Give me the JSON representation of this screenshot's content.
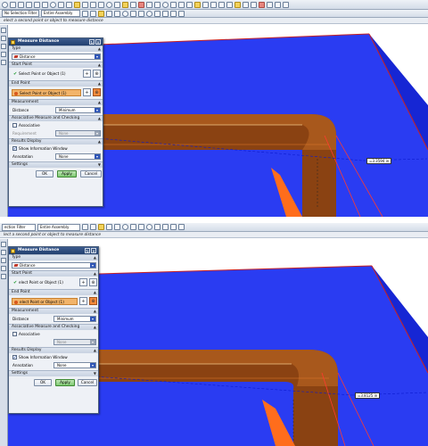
{
  "colors": {
    "accent": "#2244ff",
    "part": "#8a4212",
    "part_light": "#d8691e",
    "highlight": "#f2b46a"
  },
  "top": {
    "toolbar": {
      "selection_filter": "No Selection Filter",
      "assembly_scope": "Entire Assembly"
    },
    "cue": "elect a second point or object to measure distance",
    "dialog": {
      "title": "Measure Distance",
      "type_section": "Type",
      "type_value": "Distance",
      "start_section": "Start Point",
      "start_value": "Select Point or Object (1)",
      "end_section": "End Point",
      "end_value": "Select Point or Object (1)",
      "measurement_section": "Measurement",
      "distance_label": "Distance",
      "distance_value": "Minimum",
      "assoc_section": "Associative Measure and Checking",
      "associative_label": "Associative",
      "requirement_label": "Requirement",
      "requirement_value": "None",
      "results_section": "Results Display",
      "show_info_label": "Show Information Window",
      "annotation_label": "Annotation",
      "annotation_value": "None",
      "settings_section": "Settings",
      "ok": "OK",
      "apply": "Apply",
      "cancel": "Cancel"
    },
    "measure_label": "=3.3594 in"
  },
  "bottom": {
    "toolbar": {
      "selection_filter": "ection Filter",
      "assembly_scope": "Entire Assembly"
    },
    "cue": "lect a second point or object to measure distance",
    "dialog": {
      "title": "Measure Distance",
      "type_section": "Type",
      "type_value": "Distance",
      "start_section": "Start Point",
      "start_value": "elect Point or Object (1)",
      "end_section": "End Point",
      "end_value": "elect Point or Object (1)",
      "measurement_section": "Measurement",
      "distance_label": "Distance",
      "distance_value": "Minimum",
      "assoc_section": "Associative Measure and Checking",
      "associative_label": "Associative",
      "requirement_value": "None",
      "results_section": "Results Display",
      "show_info_label": "Show Information Window",
      "annotation_label": "Annotation",
      "annotation_value": "None",
      "settings_section": "Settings",
      "ok": "OK",
      "apply": "Apply",
      "cancel": "Cancel"
    },
    "measure_label": "=3.8125 in"
  }
}
